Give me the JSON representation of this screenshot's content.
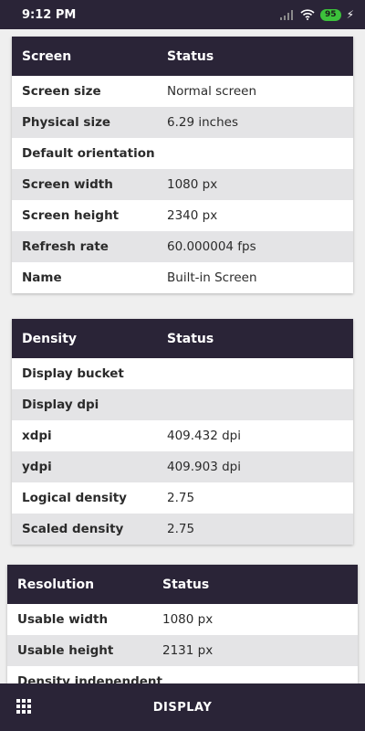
{
  "status_bar": {
    "time": "9:12 PM",
    "battery": "95"
  },
  "cards": {
    "screen": {
      "header": {
        "col1": "Screen",
        "col2": "Status"
      },
      "rows": [
        {
          "label": "Screen size",
          "value": "Normal screen"
        },
        {
          "label": "Physical size",
          "value": "6.29 inches"
        },
        {
          "label": "Default orientation",
          "value": ""
        },
        {
          "label": "Screen width",
          "value": "1080 px"
        },
        {
          "label": "Screen height",
          "value": "2340 px"
        },
        {
          "label": "Refresh rate",
          "value": "60.000004 fps"
        },
        {
          "label": "Name",
          "value": "Built-in Screen"
        }
      ]
    },
    "density": {
      "header": {
        "col1": "Density",
        "col2": "Status"
      },
      "rows": [
        {
          "label": "Display bucket",
          "value": ""
        },
        {
          "label": "Display dpi",
          "value": ""
        },
        {
          "label": "xdpi",
          "value": "409.432 dpi"
        },
        {
          "label": "ydpi",
          "value": "409.903 dpi"
        },
        {
          "label": "Logical density",
          "value": "2.75"
        },
        {
          "label": "Scaled density",
          "value": "2.75"
        }
      ]
    },
    "resolution": {
      "header": {
        "col1": "Resolution",
        "col2": "Status"
      },
      "rows": [
        {
          "label": "Usable width",
          "value": "1080 px"
        },
        {
          "label": "Usable height",
          "value": "2131 px"
        },
        {
          "label": "Density independent",
          "value": ""
        }
      ]
    }
  },
  "bottom_nav": {
    "title": "DISPLAY"
  },
  "icons": {
    "signal": "signal-icon",
    "wifi": "wifi-icon",
    "battery": "battery-icon",
    "charging": "charging-icon",
    "menu": "grid-menu-icon"
  }
}
